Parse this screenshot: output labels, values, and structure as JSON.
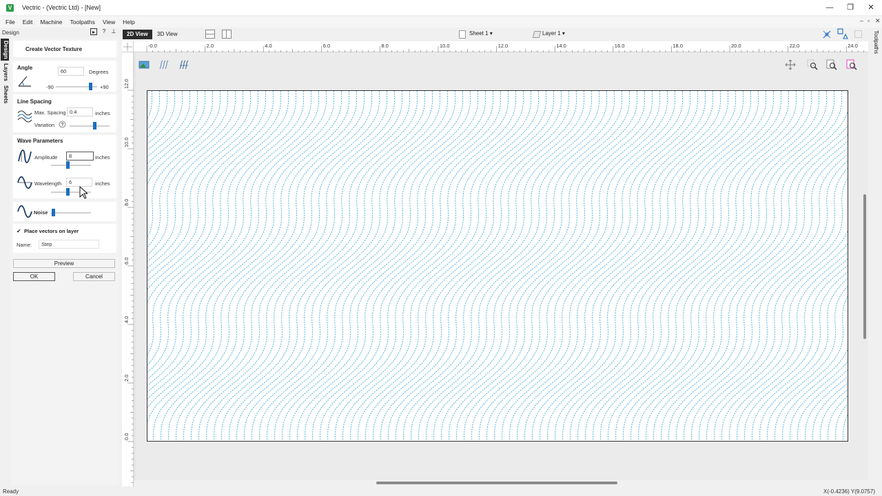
{
  "window": {
    "title": "Vectric - (Vectric Ltd) - [New]",
    "app_icon_letter": "V"
  },
  "menu": [
    "File",
    "Edit",
    "Machine",
    "Toolpaths",
    "View",
    "Help"
  ],
  "panel": {
    "header_label": "Design",
    "side_tabs": [
      "Design",
      "Layers",
      "Sheets"
    ],
    "title": "Create Vector Texture",
    "angle": {
      "section": "Angle",
      "value": "60",
      "unit": "Degrees",
      "min_label": "-90",
      "max_label": "+90",
      "slider_level": 0.83
    },
    "line_spacing": {
      "section": "Line Spacing",
      "max_spacing_label": "Max. Spacing",
      "max_spacing_value": "0.4",
      "unit": "inches",
      "variation_label": "Variation",
      "variation_level": 0.62
    },
    "wave": {
      "section": "Wave Parameters",
      "amplitude_label": "Amplitude",
      "amplitude_value": "8",
      "amplitude_unit": "inches",
      "amplitude_level": 0.42,
      "wavelength_label": "Wavelength",
      "wavelength_value": "6",
      "wavelength_unit": "inches",
      "wavelength_level": 0.42
    },
    "noise": {
      "label": "Noise",
      "level": 0.05
    },
    "layer": {
      "checkbox_label": "Place vectors on layer",
      "checked": true,
      "name_label": "Name:",
      "name_value": "Step"
    },
    "buttons": {
      "preview": "Preview",
      "ok": "OK",
      "cancel": "Cancel"
    }
  },
  "viewbar": {
    "tab_2d": "2D View",
    "tab_3d": "3D View",
    "sheet_label": "Sheet 1",
    "layer_label": "Layer 1",
    "toolpaths_tab": "Toolpaths"
  },
  "ruler": {
    "top_ticks": [
      "-0.0",
      "2.0",
      "4.0",
      "6.0",
      "8.0",
      "10.0",
      "12.0",
      "14.0",
      "16.0",
      "18.0",
      "20.0",
      "22.0",
      "24.0"
    ],
    "left_ticks": [
      "12.0",
      "10.0",
      "8.0",
      "6.0",
      "4.0",
      "2.0",
      "0.0"
    ]
  },
  "colors": {
    "accent": "#1b6fc2",
    "texture_line": "#2a9fd6",
    "active_tab": "#2d2d2d"
  },
  "status": {
    "left": "Ready",
    "right": "X(-0.4236) Y(9.0757)"
  }
}
